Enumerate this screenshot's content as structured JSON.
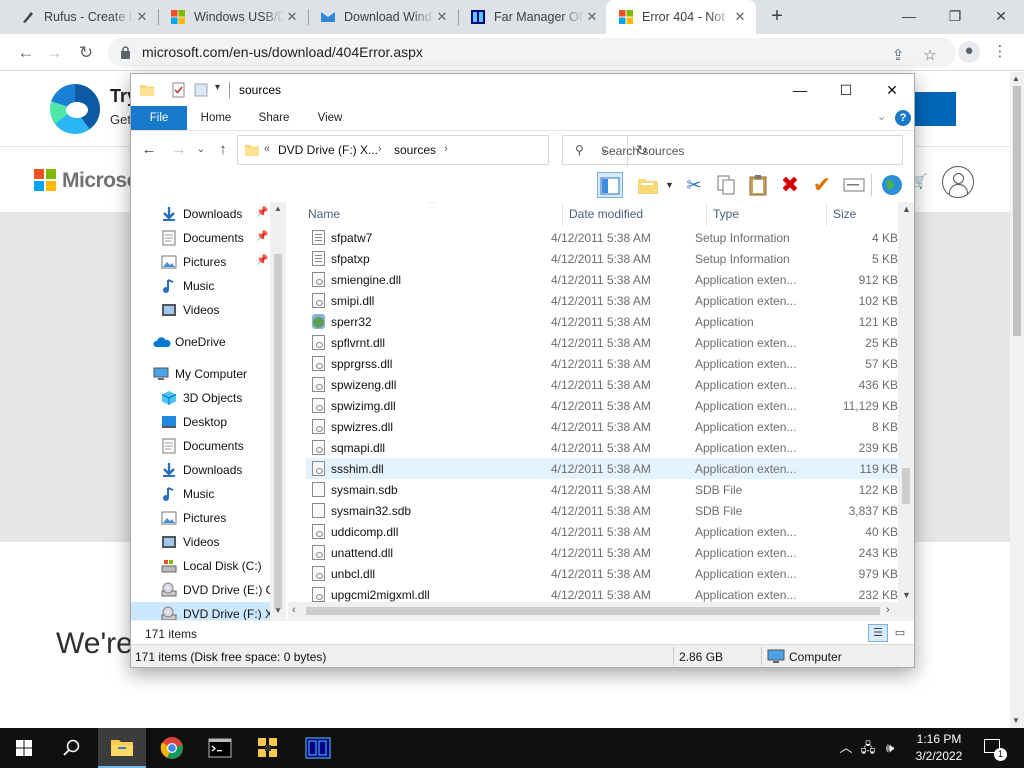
{
  "browser": {
    "tabs": [
      {
        "label": "Rufus - Create b",
        "icon": "rufus-icon"
      },
      {
        "label": "Windows USB/D",
        "icon": "windows-logo-icon"
      },
      {
        "label": "Download Wind",
        "icon": "windows-download-icon"
      },
      {
        "label": "Far Manager Of",
        "icon": "far-manager-icon"
      },
      {
        "label": "Error 404 - Not",
        "icon": "microsoft-logo-icon"
      }
    ],
    "url": "microsoft.com/en-us/download/404Error.aspx"
  },
  "webpage": {
    "banner_title": "Try",
    "banner_sub": "Get",
    "brand": "Microso",
    "heading": "We're"
  },
  "explorer": {
    "title": "sources",
    "ribbon_tabs": [
      "File",
      "Home",
      "Share",
      "View"
    ],
    "breadcrumb": [
      "DVD Drive (F:) X...",
      "sources"
    ],
    "search_placeholder": "Search sources",
    "nav": [
      {
        "label": "Downloads",
        "icon": "download-arrow-icon",
        "pinned": true
      },
      {
        "label": "Documents",
        "icon": "documents-icon",
        "pinned": true
      },
      {
        "label": "Pictures",
        "icon": "pictures-icon",
        "pinned": true
      },
      {
        "label": "Music",
        "icon": "music-note-icon",
        "pinned": false
      },
      {
        "label": "Videos",
        "icon": "videos-icon",
        "pinned": false
      },
      {
        "label": "OneDrive",
        "icon": "onedrive-cloud-icon",
        "pinned": false
      },
      {
        "label": "My Computer",
        "icon": "computer-icon",
        "pinned": false
      },
      {
        "label": "3D Objects",
        "icon": "3d-objects-icon",
        "pinned": false
      },
      {
        "label": "Desktop",
        "icon": "desktop-icon",
        "pinned": false
      },
      {
        "label": "Documents",
        "icon": "documents-icon",
        "pinned": false
      },
      {
        "label": "Downloads",
        "icon": "download-arrow-icon",
        "pinned": false
      },
      {
        "label": "Music",
        "icon": "music-note-icon",
        "pinned": false
      },
      {
        "label": "Pictures",
        "icon": "pictures-icon",
        "pinned": false
      },
      {
        "label": "Videos",
        "icon": "videos-icon",
        "pinned": false
      },
      {
        "label": "Local Disk (C:)",
        "icon": "local-disk-icon",
        "pinned": false
      },
      {
        "label": "DVD Drive (E:) CI",
        "icon": "dvd-drive-icon",
        "pinned": false
      },
      {
        "label": "DVD Drive (F:) X",
        "icon": "dvd-drive-icon",
        "pinned": false,
        "selected": true
      }
    ],
    "columns": [
      "Name",
      "Date modified",
      "Type",
      "Size"
    ],
    "files": [
      {
        "name": "sfpatw7",
        "date": "4/12/2011 5:38 AM",
        "type": "Setup Information",
        "size": "4 KB",
        "kind": "inf"
      },
      {
        "name": "sfpatxp",
        "date": "4/12/2011 5:38 AM",
        "type": "Setup Information",
        "size": "5 KB",
        "kind": "inf"
      },
      {
        "name": "smiengine.dll",
        "date": "4/12/2011 5:38 AM",
        "type": "Application exten...",
        "size": "912 KB",
        "kind": "dll"
      },
      {
        "name": "smipi.dll",
        "date": "4/12/2011 5:38 AM",
        "type": "Application exten...",
        "size": "102 KB",
        "kind": "dll"
      },
      {
        "name": "sperr32",
        "date": "4/12/2011 5:38 AM",
        "type": "Application",
        "size": "121 KB",
        "kind": "exe"
      },
      {
        "name": "spflvrnt.dll",
        "date": "4/12/2011 5:38 AM",
        "type": "Application exten...",
        "size": "25 KB",
        "kind": "dll"
      },
      {
        "name": "spprgrss.dll",
        "date": "4/12/2011 5:38 AM",
        "type": "Application exten...",
        "size": "57 KB",
        "kind": "dll"
      },
      {
        "name": "spwizeng.dll",
        "date": "4/12/2011 5:38 AM",
        "type": "Application exten...",
        "size": "436 KB",
        "kind": "dll"
      },
      {
        "name": "spwizimg.dll",
        "date": "4/12/2011 5:38 AM",
        "type": "Application exten...",
        "size": "11,129 KB",
        "kind": "dll"
      },
      {
        "name": "spwizres.dll",
        "date": "4/12/2011 5:38 AM",
        "type": "Application exten...",
        "size": "8 KB",
        "kind": "dll"
      },
      {
        "name": "sqmapi.dll",
        "date": "4/12/2011 5:38 AM",
        "type": "Application exten...",
        "size": "239 KB",
        "kind": "dll"
      },
      {
        "name": "ssshim.dll",
        "date": "4/12/2011 5:38 AM",
        "type": "Application exten...",
        "size": "119 KB",
        "kind": "dll",
        "highlight": true
      },
      {
        "name": "sysmain.sdb",
        "date": "4/12/2011 5:38 AM",
        "type": "SDB File",
        "size": "122 KB",
        "kind": "blank"
      },
      {
        "name": "sysmain32.sdb",
        "date": "4/12/2011 5:38 AM",
        "type": "SDB File",
        "size": "3,837 KB",
        "kind": "blank"
      },
      {
        "name": "uddicomp.dll",
        "date": "4/12/2011 5:38 AM",
        "type": "Application exten...",
        "size": "40 KB",
        "kind": "dll"
      },
      {
        "name": "unattend.dll",
        "date": "4/12/2011 5:38 AM",
        "type": "Application exten...",
        "size": "243 KB",
        "kind": "dll"
      },
      {
        "name": "unbcl.dll",
        "date": "4/12/2011 5:38 AM",
        "type": "Application exten...",
        "size": "979 KB",
        "kind": "dll"
      },
      {
        "name": "upgcmi2migxml.dll",
        "date": "4/12/2011 5:38 AM",
        "type": "Application exten...",
        "size": "232 KB",
        "kind": "dll"
      }
    ],
    "item_count": "171 items",
    "status_left": "171 items (Disk free space: 0 bytes)",
    "status_size": "2.86 GB",
    "status_location": "Computer"
  },
  "taskbar": {
    "time": "1:16 PM",
    "date": "3/2/2022",
    "notifications": "1"
  }
}
